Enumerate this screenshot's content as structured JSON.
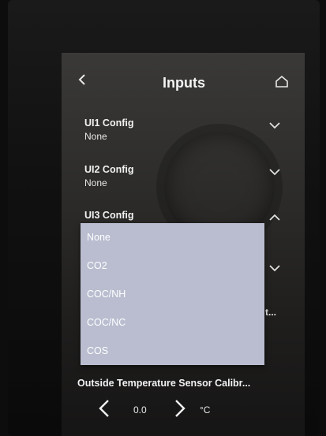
{
  "header": {
    "title": "Inputs"
  },
  "rows": [
    {
      "label": "UI1 Config",
      "value": "None"
    },
    {
      "label": "UI2 Config",
      "value": "None"
    },
    {
      "label": "UI3 Config"
    }
  ],
  "dropdown": {
    "options": [
      "None",
      "CO2",
      "COC/NH",
      "COC/NC",
      "COS"
    ]
  },
  "truncated_text": "t...",
  "calibration": {
    "label": "Outside Temperature Sensor Calibr...",
    "value": "0.0",
    "unit": "°C"
  },
  "icons": {
    "back": "chevron-left-icon",
    "home": "home-icon",
    "expand": "chevron-down-icon",
    "collapse": "chevron-up-icon"
  }
}
